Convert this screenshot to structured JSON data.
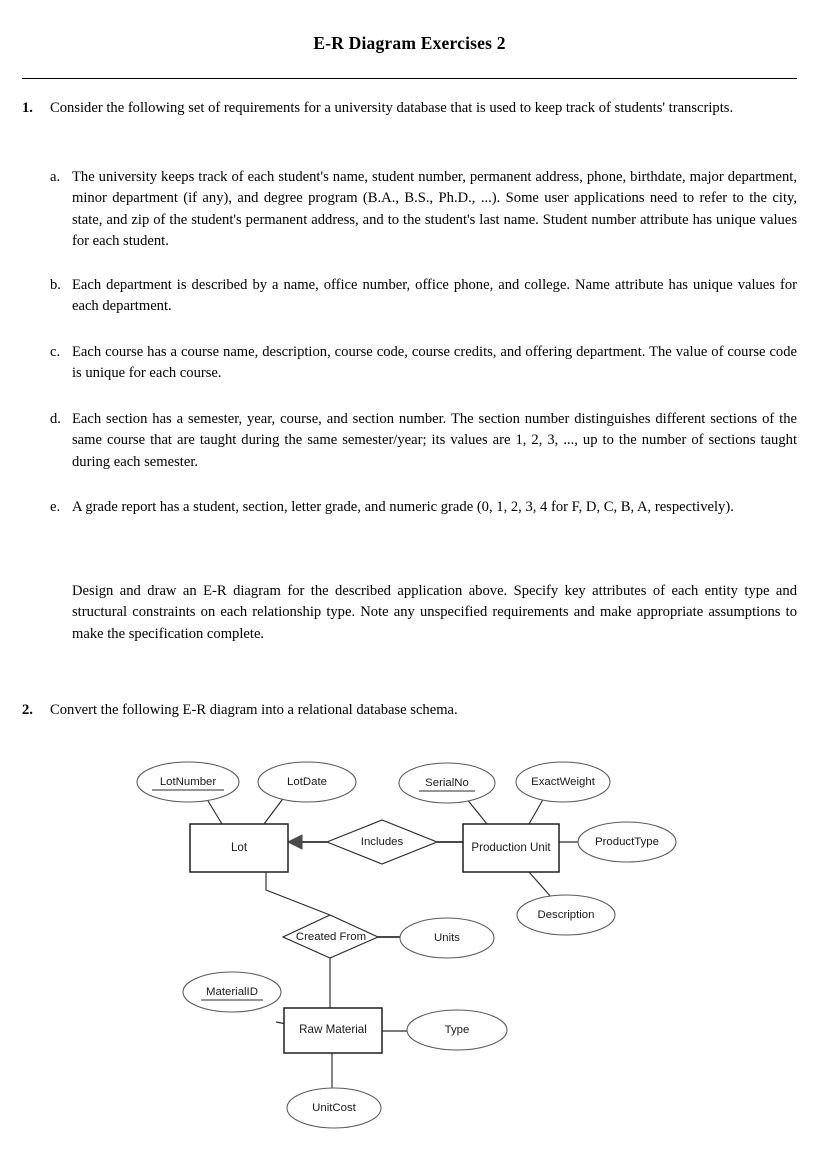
{
  "document": {
    "title": "E-R Diagram Exercises 2"
  },
  "questions": [
    {
      "number": "1.",
      "intro": "Consider the following set of requirements for a university database that is used to keep track of students' transcripts.",
      "subitems": [
        {
          "label": "a.",
          "text": "The university keeps track of each student's name, student number, permanent address, phone, birthdate, major department, minor department (if any), and degree program (B.A., B.S., Ph.D., ...). Some user applications need to refer to the city, state, and zip of the student's permanent address, and to the student's last name. Student number attribute has unique values for each student."
        },
        {
          "label": "b.",
          "text": "Each department is described by a name, office number, office phone, and college. Name attribute has unique values for each department."
        },
        {
          "label": "c.",
          "text": "Each course has a course name, description, course code, course credits, and offering department. The value of course code is unique for each course."
        },
        {
          "label": "d.",
          "text": "Each section has a semester, year, course, and section number. The section number distinguishes different sections of the same course that are taught during the same semester/year; its values are 1, 2, 3, ..., up to the number of sections taught during each semester."
        },
        {
          "label": "e.",
          "text": "A grade report has a student, section, letter grade, and numeric grade (0, 1, 2, 3, 4 for F, D, C, B, A, respectively)."
        }
      ],
      "closing": "Design and draw an E-R diagram for the described application above. Specify key attributes of each entity type and structural constraints on each relationship type. Note any unspecified requirements and make appropriate assumptions to make the specification complete."
    },
    {
      "number": "2.",
      "intro": "Convert the following E-R diagram into a relational database schema.",
      "subitems": [],
      "closing": ""
    }
  ],
  "er_diagram": {
    "entities": [
      {
        "id": "lot",
        "label": "Lot"
      },
      {
        "id": "production_unit",
        "label": "Production Unit"
      },
      {
        "id": "raw_material",
        "label": "Raw Material"
      }
    ],
    "relationships": [
      {
        "id": "includes",
        "label": "Includes"
      },
      {
        "id": "created_from",
        "label": "Created From"
      }
    ],
    "attributes": [
      {
        "id": "lotnumber",
        "label": "LotNumber",
        "key": true,
        "owner": "lot"
      },
      {
        "id": "lotdate",
        "label": "LotDate",
        "key": false,
        "owner": "lot"
      },
      {
        "id": "serialno",
        "label": "SerialNo",
        "key": true,
        "owner": "production_unit"
      },
      {
        "id": "exactweight",
        "label": "ExactWeight",
        "key": false,
        "owner": "production_unit"
      },
      {
        "id": "producttype",
        "label": "ProductType",
        "key": false,
        "owner": "production_unit"
      },
      {
        "id": "description",
        "label": "Description",
        "key": false,
        "owner": "production_unit"
      },
      {
        "id": "units",
        "label": "Units",
        "key": false,
        "owner": "created_from"
      },
      {
        "id": "materialid",
        "label": "MaterialID",
        "key": true,
        "owner": "raw_material"
      },
      {
        "id": "type",
        "label": "Type",
        "key": false,
        "owner": "raw_material"
      },
      {
        "id": "unitcost",
        "label": "UnitCost",
        "key": false,
        "owner": "raw_material"
      }
    ]
  }
}
